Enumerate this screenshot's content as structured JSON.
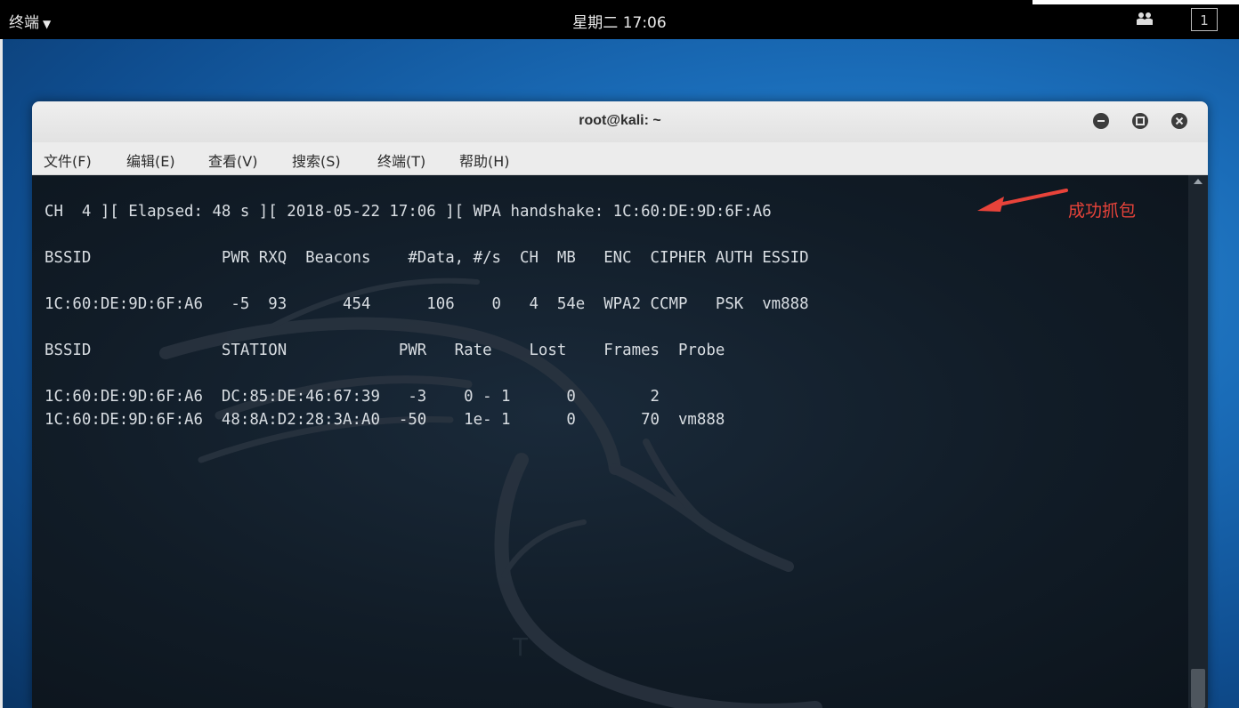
{
  "topbar": {
    "app_menu": "终端",
    "clock": "星期二 17:06",
    "workspace": "1",
    "icons": [
      "chevron-down-icon",
      "system-status-icon"
    ]
  },
  "window": {
    "title": "root@kali: ~",
    "buttons": [
      "minimize",
      "maximize",
      "close"
    ],
    "menu": [
      "文件(F)",
      "编辑(E)",
      "查看(V)",
      "搜索(S)",
      "终端(T)",
      "帮助(H)"
    ]
  },
  "terminal": {
    "lines": [
      "CH  4 ][ Elapsed: 48 s ][ 2018-05-22 17:06 ][ WPA handshake: 1C:60:DE:9D:6F:A6",
      "BSSID              PWR RXQ  Beacons    #Data, #/s  CH  MB   ENC  CIPHER AUTH ESSID",
      "1C:60:DE:9D:6F:A6   -5  93      454      106    0   4  54e  WPA2 CCMP   PSK  vm888",
      "BSSID              STATION            PWR   Rate    Lost    Frames  Probe",
      "1C:60:DE:9D:6F:A6  DC:85:DE:46:67:39   -3    0 - 1      0        2",
      "1C:60:DE:9D:6F:A6  48:8A:D2:28:3A:A0  -50    1e- 1      0       70  vm888"
    ]
  },
  "annotation": {
    "text": "成功抓包",
    "color": "#e8433a"
  }
}
